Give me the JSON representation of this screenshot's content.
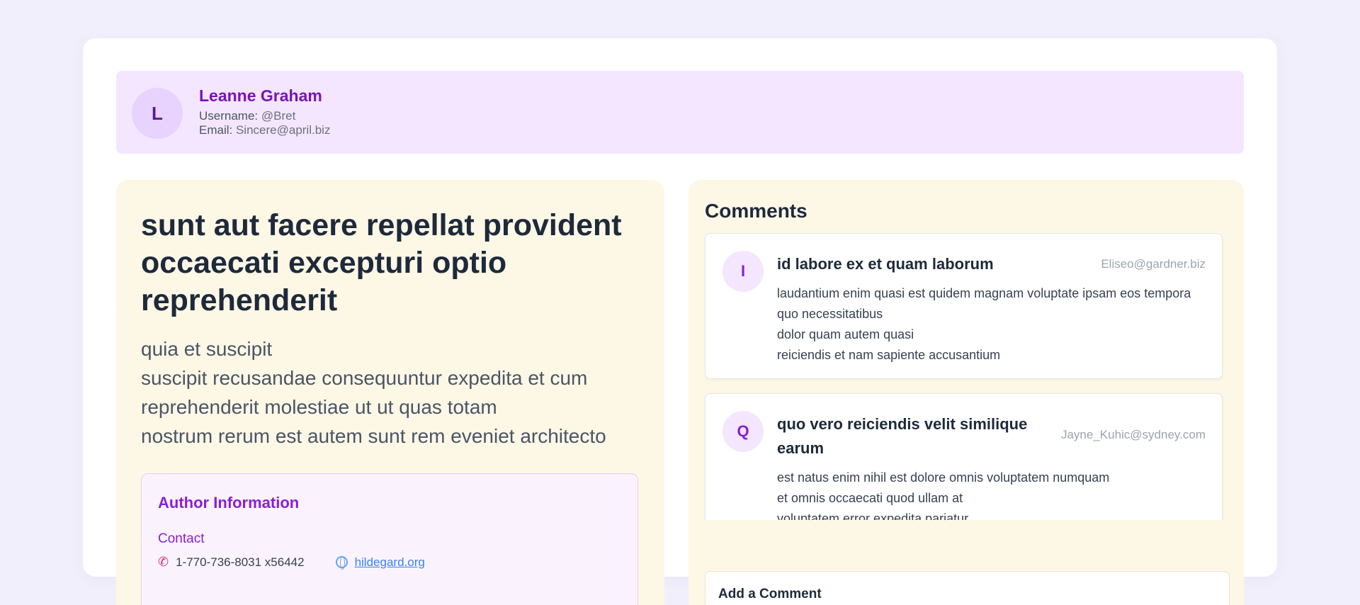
{
  "user": {
    "avatar_initial": "L",
    "name": "Leanne Graham",
    "username_label": "Username:",
    "username": "@Bret",
    "email_label": "Email:",
    "email": "Sincere@april.biz"
  },
  "post": {
    "title": "sunt aut facere repellat provident occaecati excepturi optio reprehenderit",
    "body": "quia et suscipit\nsuscipit recusandae consequuntur expedita et cum reprehenderit molestiae ut ut quas totam\nnostrum rerum est autem sunt rem eveniet architecto"
  },
  "author": {
    "section_title": "Author Information",
    "contact_label": "Contact",
    "phone": "1-770-736-8031 x56442",
    "website": "hildegard.org"
  },
  "comments": {
    "title": "Comments",
    "items": [
      {
        "initial": "I",
        "name": "id labore ex et quam laborum",
        "email": "Eliseo@gardner.biz",
        "body": "laudantium enim quasi est quidem magnam voluptate ipsam eos tempora quo necessitatibus\ndolor quam autem quasi\nreiciendis et nam sapiente accusantium"
      },
      {
        "initial": "Q",
        "name": "quo vero reiciendis velit similique earum",
        "email": "Jayne_Kuhic@sydney.com",
        "body": "est natus enim nihil est dolore omnis voluptatem numquam\net omnis occaecati quod ullam at\nvoluptatem error expedita pariatur"
      }
    ]
  },
  "add_comment": {
    "title": "Add a Comment"
  }
}
